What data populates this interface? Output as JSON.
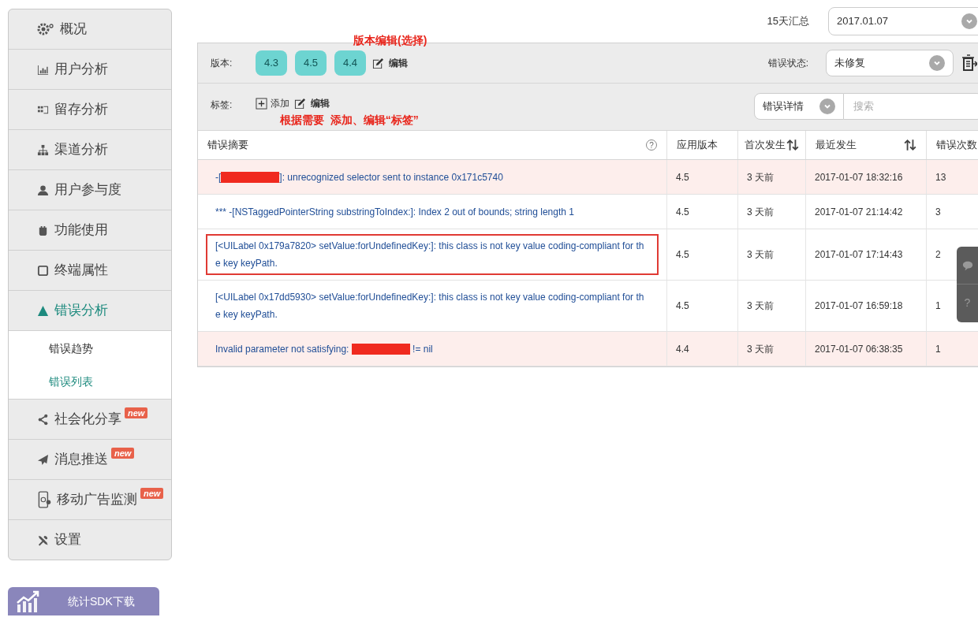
{
  "sidebar": {
    "items": [
      {
        "label": "概况",
        "expanded": false
      },
      {
        "label": "用户分析",
        "expanded": false
      },
      {
        "label": "留存分析",
        "expanded": false
      },
      {
        "label": "渠道分析",
        "expanded": false
      },
      {
        "label": "用户参与度",
        "expanded": false
      },
      {
        "label": "功能使用",
        "expanded": false
      },
      {
        "label": "终端属性",
        "expanded": false
      },
      {
        "label": "错误分析",
        "expanded": true,
        "children": [
          {
            "label": "错误趋势",
            "selected": false
          },
          {
            "label": "错误列表",
            "selected": true
          }
        ]
      },
      {
        "label": "社会化分享",
        "expanded": false,
        "badge": "new"
      },
      {
        "label": "消息推送",
        "expanded": false,
        "badge": "new"
      },
      {
        "label": "移动广告监测",
        "expanded": false,
        "badge": "new"
      },
      {
        "label": "设置",
        "expanded": false
      }
    ],
    "download_button": "统计SDK下载"
  },
  "top": {
    "period_label": "15天汇总",
    "date": "2017.01.07"
  },
  "filters": {
    "version_label": "版本:",
    "versions": [
      "4.3",
      "4.5",
      "4.4"
    ],
    "version_edit": "编辑",
    "version_note": "版本编辑(选择)",
    "status_label": "错误状态:",
    "status": "未修复",
    "tag_label": "标签:",
    "tag_add": "添加",
    "tag_edit": "编辑",
    "tag_note": "根据需要  添加、编辑“标签”",
    "detail_select": "错误详情",
    "search_placeholder": "搜索"
  },
  "table": {
    "summary_help": "?",
    "columns": [
      "错误摘要",
      "应用版本",
      "首次发生",
      "最近发生",
      "错误次数"
    ],
    "rows": [
      {
        "highlighted": true,
        "outlined": false,
        "summary_before": "-[",
        "redacted": true,
        "summary_after": "]: unrecognized selector sent to instance 0x171c5740",
        "version": "4.5",
        "first": "3 天前",
        "last": "2017-01-07 18:32:16",
        "count": "13"
      },
      {
        "highlighted": false,
        "outlined": false,
        "summary_before": "*** -[NSTaggedPointerString substringToIndex:]: Index 2 out of bounds; string length 1",
        "redacted": false,
        "summary_after": "",
        "version": "4.5",
        "first": "3 天前",
        "last": "2017-01-07 21:14:42",
        "count": "3"
      },
      {
        "highlighted": false,
        "outlined": true,
        "summary_before": "[<UILabel 0x179a7820> setValue:forUndefinedKey:]: this class is not key value coding-compliant for the key keyPath.",
        "redacted": false,
        "summary_after": "",
        "version": "4.5",
        "first": "3 天前",
        "last": "2017-01-07 17:14:43",
        "count": "2"
      },
      {
        "highlighted": false,
        "outlined": false,
        "summary_before": "[<UILabel 0x17dd5930> setValue:forUndefinedKey:]: this class is not key value coding-compliant for the key keyPath.",
        "redacted": false,
        "summary_after": "",
        "version": "4.5",
        "first": "3 天前",
        "last": "2017-01-07 16:59:18",
        "count": "1"
      },
      {
        "highlighted": true,
        "outlined": false,
        "summary_before": "Invalid parameter not satisfying: ",
        "redacted": true,
        "summary_after": " != nil",
        "version": "4.4",
        "first": "3 天前",
        "last": "2017-01-07 06:38:35",
        "count": "1"
      }
    ]
  },
  "side_tabs": {
    "help": "?"
  }
}
